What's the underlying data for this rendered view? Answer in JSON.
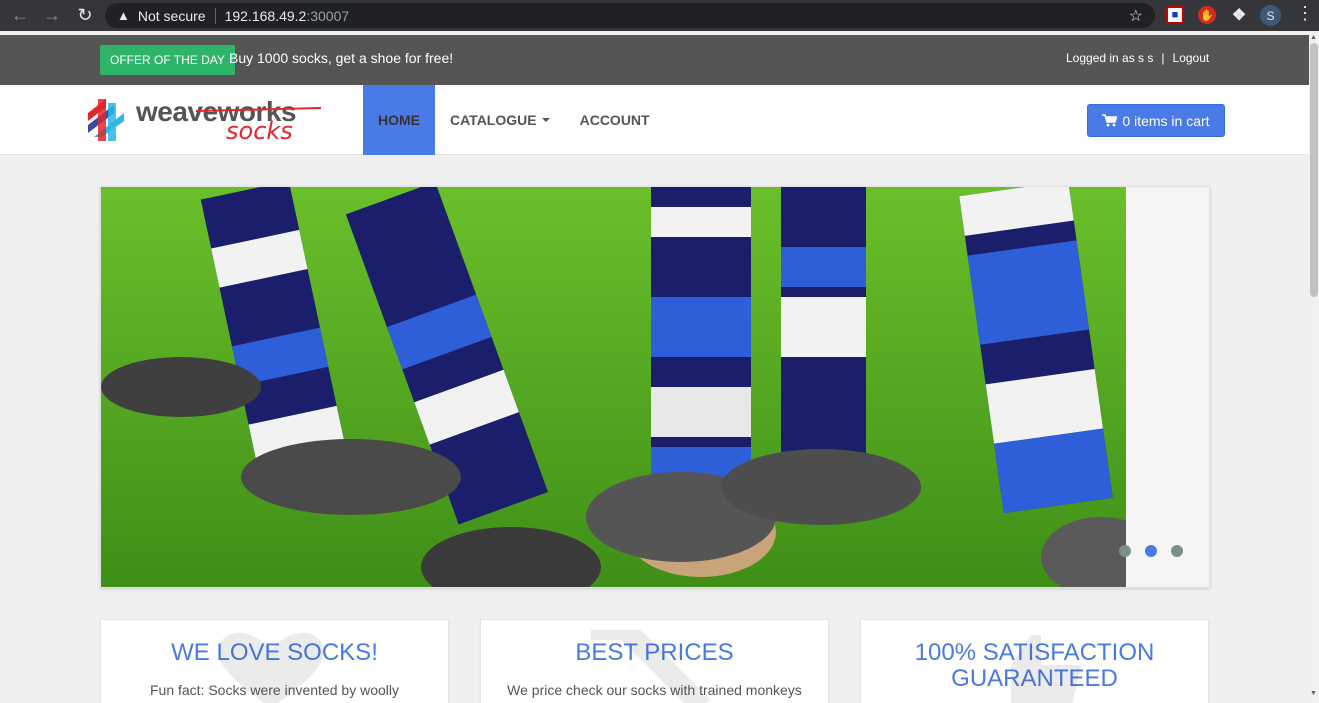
{
  "browser": {
    "security_label": "Not secure",
    "url_host": "192.168.49.2",
    "url_port": ":30007",
    "profile_initial": "S"
  },
  "topbar": {
    "offer_badge": "OFFER OF THE DAY",
    "offer_text": "Buy 1000 socks, get a shoe for free!",
    "logged_in": "Logged in as s s",
    "divider": "|",
    "logout": "Logout"
  },
  "navbar": {
    "items": [
      {
        "label": "HOME"
      },
      {
        "label": "CATALOGUE"
      },
      {
        "label": "ACCOUNT"
      }
    ],
    "cart_label": "0 items in cart"
  },
  "carousel": {
    "slide_count": 3,
    "active_index": 1
  },
  "features": [
    {
      "title": "WE LOVE SOCKS!",
      "text": "Fun fact: Socks were invented by woolly"
    },
    {
      "title": "BEST PRICES",
      "text": "We price check our socks with trained monkeys"
    },
    {
      "title": "100% SATISFACTION GUARANTEED",
      "text": ""
    }
  ],
  "colors": {
    "accent": "#4a7ae6",
    "offer_green": "#2fb56a",
    "topbar_gray": "#555555"
  }
}
